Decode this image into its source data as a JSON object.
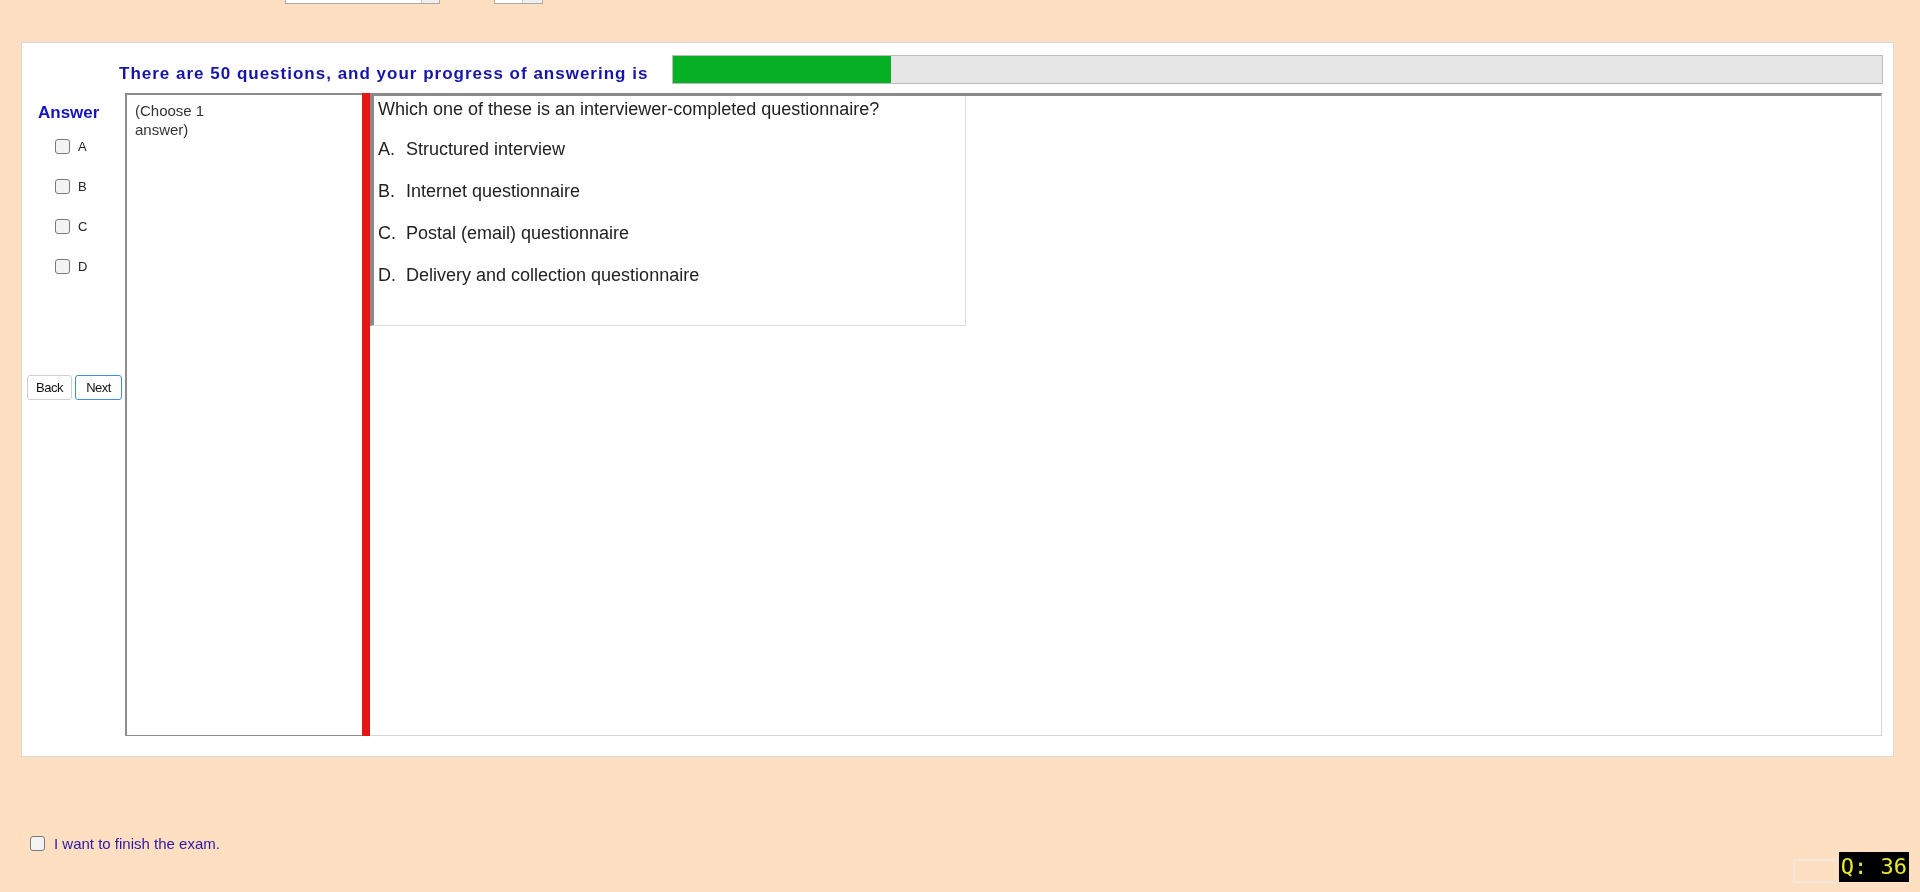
{
  "progress": {
    "label": "There are 50 questions, and your progress of answering is",
    "level": 0.18
  },
  "answer_panel": {
    "title": "Answer",
    "options": [
      {
        "label": "A",
        "checked": false
      },
      {
        "label": "B",
        "checked": false
      },
      {
        "label": "C",
        "checked": false
      },
      {
        "label": "D",
        "checked": false
      }
    ],
    "buttons": [
      {
        "label": "Back",
        "focused": false
      },
      {
        "label": "Next",
        "focused": true
      }
    ]
  },
  "instruction": "(Choose 1 answer)",
  "question": {
    "text": "Which one of these is an interviewer-completed questionnaire?",
    "options": [
      {
        "letter": "A.",
        "text": "Structured interview"
      },
      {
        "letter": "B.",
        "text": "Internet questionnaire"
      },
      {
        "letter": "C.",
        "text": "Postal (email) questionnaire"
      },
      {
        "letter": "D.",
        "text": "Delivery and collection questionnaire"
      }
    ]
  },
  "finish": {
    "label": "I want to finish the exam.",
    "checked": false
  },
  "question_badge": "Q: 36"
}
